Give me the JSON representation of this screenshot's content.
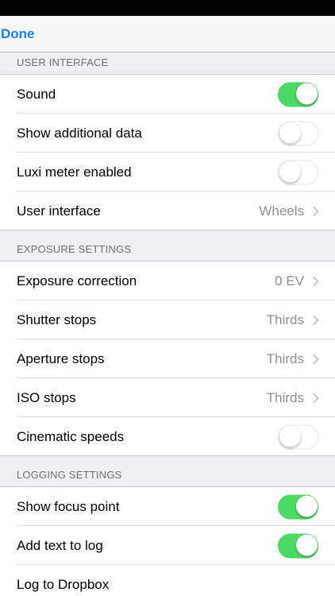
{
  "navbar": {
    "done_label": "Done"
  },
  "sections": {
    "user_interface": {
      "header": "USER INTERFACE",
      "sound": {
        "label": "Sound",
        "on": true
      },
      "show_additional_data": {
        "label": "Show additional data",
        "on": false
      },
      "luxi_meter": {
        "label": "Luxi meter enabled",
        "on": false
      },
      "user_interface": {
        "label": "User interface",
        "value": "Wheels"
      }
    },
    "exposure_settings": {
      "header": "EXPOSURE SETTINGS",
      "exposure_correction": {
        "label": "Exposure correction",
        "value": "0 EV"
      },
      "shutter_stops": {
        "label": "Shutter stops",
        "value": "Thirds"
      },
      "aperture_stops": {
        "label": "Aperture stops",
        "value": "Thirds"
      },
      "iso_stops": {
        "label": "ISO stops",
        "value": "Thirds"
      },
      "cinematic_speeds": {
        "label": "Cinematic speeds",
        "on": false
      }
    },
    "logging_settings": {
      "header": "LOGGING SETTINGS",
      "show_focus_point": {
        "label": "Show focus point",
        "on": true
      },
      "add_text_to_log": {
        "label": "Add text to log",
        "on": true
      },
      "log_to_dropbox": {
        "label": "Log to Dropbox"
      }
    }
  },
  "colors": {
    "accent": "#1a7ff5",
    "toggle_on": "#4cd964",
    "background": "#efeff4"
  }
}
